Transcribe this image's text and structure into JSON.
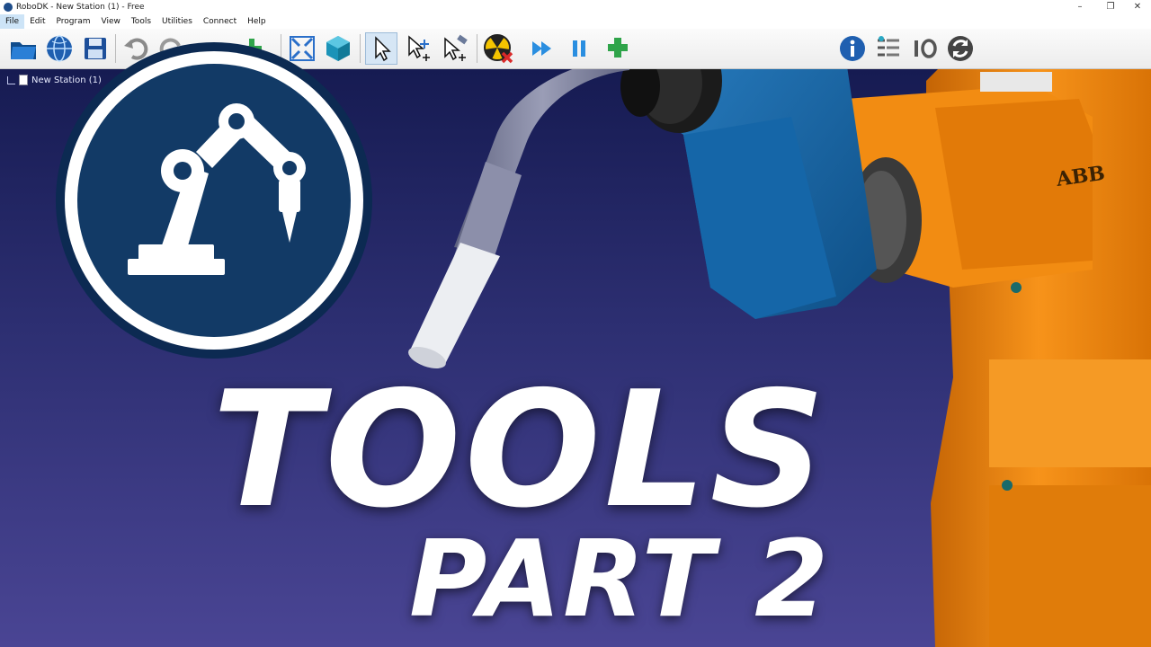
{
  "window": {
    "title": "RoboDK - New Station (1) - Free",
    "controls": [
      "–",
      "❐",
      "✕"
    ]
  },
  "menu": {
    "items": [
      "File",
      "Edit",
      "Program",
      "View",
      "Tools",
      "Utilities",
      "Connect",
      "Help"
    ]
  },
  "toolbar": {
    "icons": [
      "open-folder-icon",
      "globe-icon",
      "save-icon",
      "undo-icon",
      "redo-icon",
      "add-tool-icon",
      "fit-all-icon",
      "cube-icon",
      "select-icon",
      "move-reference-icon",
      "move-tool-icon",
      "collision-icon",
      "run-program-icon",
      "pause-icon",
      "add-target-icon",
      "info-icon",
      "program-list-icon",
      "io-icon",
      "refresh-icon"
    ],
    "colors": {
      "blue": "#2a6fc9",
      "teal": "#2aa8c4",
      "green": "#2fa44a",
      "red": "#d92a2a",
      "yellow": "#f4c400"
    }
  },
  "tree": {
    "root_label": "New Station (1)"
  },
  "headline": {
    "title": "TOOLS",
    "subtitle": "PART 2"
  },
  "robot": {
    "brand": "ABB",
    "colors": {
      "arm": "#f08a12",
      "tool_holder": "#1b66a8",
      "torch": "#7b7e9a",
      "nozzle": "#eceef2"
    }
  }
}
